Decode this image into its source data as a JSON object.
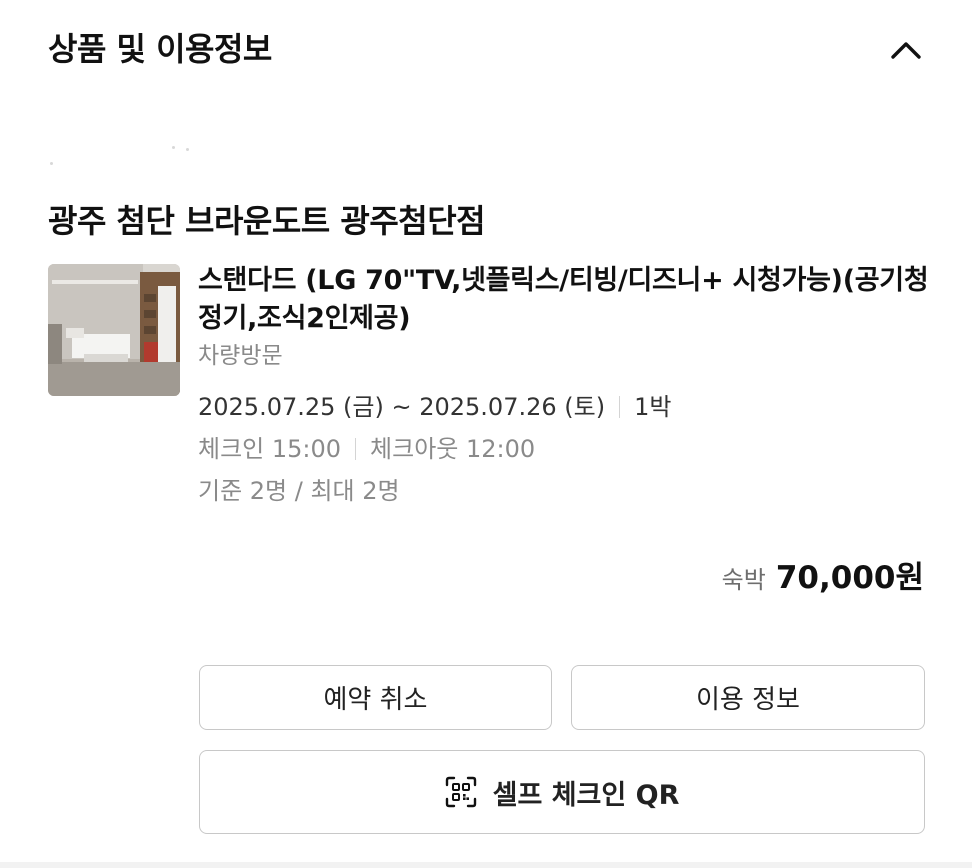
{
  "section": {
    "title": "상품 및 이용정보",
    "collapse_icon": "chevron-up-icon"
  },
  "store": {
    "name": "광주 첨단 브라운도트 광주첨단점"
  },
  "room": {
    "name": "스탠다드 (LG 70\"TV,넷플릭스/티빙/디즈니+ 시청가능)(공기청정기,조식2인제공)",
    "visit_type": "차량방문",
    "thumbnail_alt": "hotel-room-photo"
  },
  "stay": {
    "dates": "2025.07.25 (금) ~ 2025.07.26 (토)",
    "nights": "1박",
    "checkin": "체크인 15:00",
    "checkout": "체크아웃 12:00",
    "occupancy": "기준 2명 / 최대 2명"
  },
  "price": {
    "label": "숙박",
    "value": "70,000원"
  },
  "buttons": {
    "cancel": "예약 취소",
    "info": "이용 정보",
    "qr": "셀프 체크인 QR",
    "qr_icon": "qr-scan-icon"
  }
}
